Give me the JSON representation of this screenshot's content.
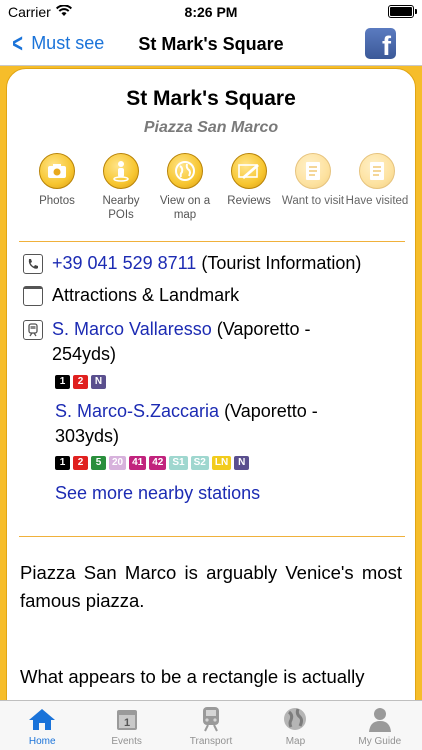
{
  "status": {
    "carrier": "Carrier",
    "time": "8:26 PM"
  },
  "nav": {
    "back_label": "Must see",
    "title": "St Mark's Square"
  },
  "place": {
    "name": "St Mark's Square",
    "local_name": "Piazza San Marco"
  },
  "actions": [
    {
      "label": "Photos",
      "icon": "camera-icon"
    },
    {
      "label": "Nearby POIs",
      "icon": "person-pin-icon"
    },
    {
      "label": "View on a map",
      "icon": "globe-icon"
    },
    {
      "label": "Reviews",
      "icon": "pencil-icon"
    },
    {
      "label": "Want to visit",
      "icon": "checklist-icon"
    },
    {
      "label": "Have visited",
      "icon": "checklist-icon"
    }
  ],
  "info": {
    "phone": "+39 041 529 8711",
    "phone_note": "(Tourist Information)",
    "category": "Attractions & Landmark",
    "stations": [
      {
        "name": "S. Marco Vallaresso",
        "detail": "(Vaporetto -",
        "distance": "254yds)",
        "lines": [
          {
            "label": "1",
            "color": "#000000"
          },
          {
            "label": "2",
            "color": "#e0201f"
          },
          {
            "label": "N",
            "color": "#5a4f8e"
          }
        ]
      },
      {
        "name": "S. Marco-S.Zaccaria",
        "detail": "(Vaporetto -",
        "distance": "303yds)",
        "lines": [
          {
            "label": "1",
            "color": "#000000"
          },
          {
            "label": "2",
            "color": "#e0201f"
          },
          {
            "label": "5",
            "color": "#2a8f3c"
          },
          {
            "label": "20",
            "color": "#d7b2dc"
          },
          {
            "label": "41",
            "color": "#c1237d"
          },
          {
            "label": "42",
            "color": "#c1237d"
          },
          {
            "label": "S1",
            "color": "#9fd7cf"
          },
          {
            "label": "S2",
            "color": "#9fd7cf"
          },
          {
            "label": "LN",
            "color": "#f2cc1d"
          },
          {
            "label": "N",
            "color": "#5a4f8e"
          }
        ]
      }
    ],
    "more_stations": "See more nearby stations"
  },
  "description": {
    "para1": "Piazza San Marco is arguably Venice's most famous piazza.",
    "para2": "What appears to be a rectangle is actually"
  },
  "tabs": [
    {
      "label": "Home",
      "icon": "home-icon",
      "active": true
    },
    {
      "label": "Events",
      "icon": "calendar-icon",
      "active": false
    },
    {
      "label": "Transport",
      "icon": "train-icon",
      "active": false
    },
    {
      "label": "Map",
      "icon": "globe-icon",
      "active": false
    },
    {
      "label": "My Guide",
      "icon": "user-icon",
      "active": false
    }
  ],
  "colors": {
    "accent": "#1a73d9",
    "frame": "#f6bd2a",
    "link": "#1c2bb3",
    "facebook": "#3b5998"
  }
}
